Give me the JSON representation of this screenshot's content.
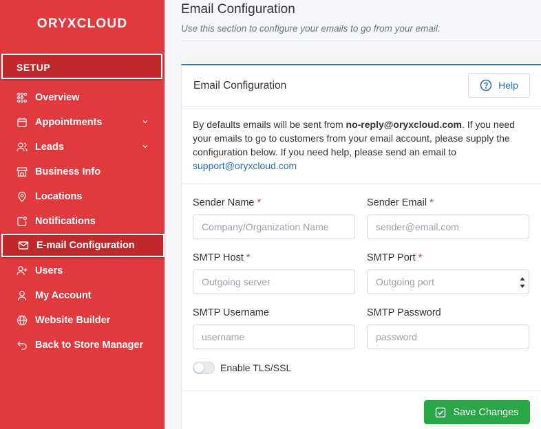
{
  "brand": "ORYXCLOUD",
  "sidebar": {
    "section": "SETUP",
    "items": [
      {
        "label": "Overview",
        "icon": "overview-icon"
      },
      {
        "label": "Appointments",
        "icon": "calendar-icon"
      },
      {
        "label": "Leads",
        "icon": "users-icon"
      },
      {
        "label": "Business Info",
        "icon": "store-icon"
      },
      {
        "label": "Locations",
        "icon": "map-pin-icon"
      },
      {
        "label": "Notifications",
        "icon": "bell-icon"
      },
      {
        "label": "E-mail Configuration",
        "icon": "mail-icon"
      },
      {
        "label": "Users",
        "icon": "user-plus-icon"
      },
      {
        "label": "My Account",
        "icon": "user-icon"
      },
      {
        "label": "Website Builder",
        "icon": "globe-icon"
      },
      {
        "label": "Back to Store Manager",
        "icon": "back-arrow-icon"
      }
    ]
  },
  "header": {
    "title": "Email Configuration",
    "subtitle": "Use this section to configure your emails to go from your email."
  },
  "card": {
    "title": "Email Configuration",
    "help_label": "Help",
    "intro_before": "By defaults emails will be sent from ",
    "intro_email": "no-reply@oryxcloud.com",
    "intro_after": ". If you need your emails to go to customers from your email account, please supply the configuration below. If you need help, please send an email to ",
    "intro_link": "support@oryxcloud.com"
  },
  "form": {
    "sender_name": {
      "label": "Sender Name",
      "placeholder": "Company/Organization Name",
      "value": ""
    },
    "sender_email": {
      "label": "Sender Email",
      "placeholder": "sender@email.com",
      "value": ""
    },
    "smtp_host": {
      "label": "SMTP Host",
      "placeholder": "Outgoing server",
      "value": ""
    },
    "smtp_port": {
      "label": "SMTP Port",
      "placeholder": "Outgoing port",
      "value": ""
    },
    "smtp_username": {
      "label": "SMTP Username",
      "placeholder": "username",
      "value": ""
    },
    "smtp_password": {
      "label": "SMTP Password",
      "placeholder": "password",
      "value": ""
    },
    "required_mark": "*",
    "tls_label": "Enable TLS/SSL",
    "tls_enabled": false,
    "save_label": "Save Changes"
  },
  "colors": {
    "sidebar": "#e03a3e",
    "sidebar_active": "#c0282c",
    "accent": "#2b7bd5",
    "link": "#2b6cb0",
    "success": "#28a745",
    "required": "#e03a3e"
  }
}
